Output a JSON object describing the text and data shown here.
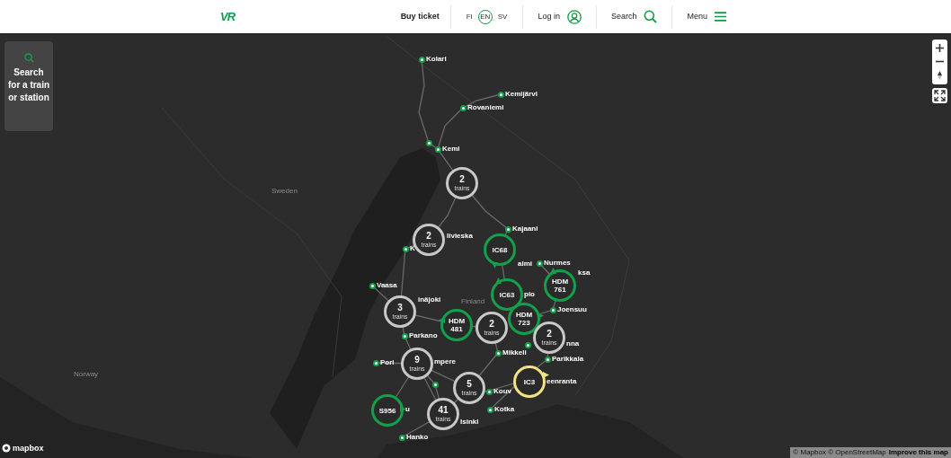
{
  "header": {
    "logo": "VR",
    "buy_ticket": "Buy ticket",
    "languages": [
      {
        "label": "FI",
        "selected": false
      },
      {
        "label": "EN",
        "selected": true
      },
      {
        "label": "SV",
        "selected": false
      }
    ],
    "login": "Log in",
    "search": "Search",
    "menu": "Menu"
  },
  "map": {
    "search_panel": "Search for a train or station",
    "countries": [
      "Sweden",
      "Finland",
      "Norway"
    ],
    "stations": [
      "Kolari",
      "Kemijärvi",
      "Rovaniemi",
      "Kemi",
      "Kajaani",
      "K",
      "Nurmes",
      "Vaasa",
      "Joensuu",
      "Parkano",
      "Pori",
      "Mikkeli",
      "Parikkala",
      "Kouv",
      "Kotka",
      "Hanko"
    ],
    "labels": [
      "livieska",
      "almi",
      "ksa",
      "inäjoki",
      "pio",
      "mpere",
      "eenranta",
      "u",
      "lsinki",
      "nna"
    ],
    "markers": [
      {
        "kind": "cluster",
        "count": "2",
        "unit": "trains"
      },
      {
        "kind": "cluster",
        "count": "2",
        "unit": "trains"
      },
      {
        "kind": "train",
        "label": "IC68",
        "color": "#12a04a"
      },
      {
        "kind": "train",
        "label": "HDM 761",
        "color": "#12a04a"
      },
      {
        "kind": "train",
        "label": "IC63",
        "color": "#12a04a"
      },
      {
        "kind": "cluster",
        "count": "3",
        "unit": "trains"
      },
      {
        "kind": "train",
        "label": "HDM 481",
        "color": "#12a04a"
      },
      {
        "kind": "cluster",
        "count": "2",
        "unit": "trains"
      },
      {
        "kind": "train",
        "label": "HDM 723",
        "color": "#12a04a"
      },
      {
        "kind": "cluster",
        "count": "2",
        "unit": "trains"
      },
      {
        "kind": "cluster",
        "count": "9",
        "unit": "trains"
      },
      {
        "kind": "train",
        "label": "IC3",
        "color": "#f2e384"
      },
      {
        "kind": "cluster",
        "count": "5",
        "unit": "trains"
      },
      {
        "kind": "train",
        "label": "S956",
        "color": "#12a04a"
      },
      {
        "kind": "cluster",
        "count": "41",
        "unit": "trains"
      }
    ],
    "attribution": "© Mapbox © OpenStreetMap",
    "improve_link": "Improve this map",
    "mapbox_logo": "mapbox"
  }
}
